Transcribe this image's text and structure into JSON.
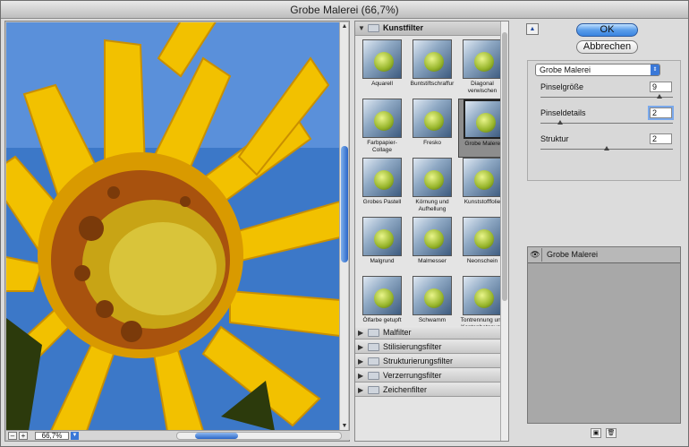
{
  "window": {
    "title": "Grobe Malerei (66,7%)"
  },
  "preview": {
    "zoom": "66,7%",
    "zoom_out": "–",
    "zoom_in": "+"
  },
  "gallery": {
    "open_category": "Kunstfilter",
    "filters": [
      {
        "name": "Aquarell",
        "selected": false
      },
      {
        "name": "Buntstiftschraffur",
        "selected": false
      },
      {
        "name": "Diagonal verwischen",
        "selected": false
      },
      {
        "name": "Farbpapier-Collage",
        "selected": false
      },
      {
        "name": "Fresko",
        "selected": false
      },
      {
        "name": "Grobe Malerei",
        "selected": true
      },
      {
        "name": "Grobes Pastell",
        "selected": false
      },
      {
        "name": "Körnung und Aufhellung",
        "selected": false
      },
      {
        "name": "Kunststofffolie",
        "selected": false
      },
      {
        "name": "Malgrund",
        "selected": false
      },
      {
        "name": "Malmesser",
        "selected": false
      },
      {
        "name": "Neonschein",
        "selected": false
      },
      {
        "name": "Ölfarbe getupft",
        "selected": false
      },
      {
        "name": "Schwamm",
        "selected": false
      },
      {
        "name": "Tontrennung und Kantenbetonung",
        "selected": false
      }
    ],
    "categories": [
      "Malfilter",
      "Stilisierungsfilter",
      "Strukturierungsfilter",
      "Verzerrungsfilter",
      "Zeichenfilter"
    ]
  },
  "buttons": {
    "ok": "OK",
    "cancel": "Abbrechen"
  },
  "settings": {
    "filter_select": "Grobe Malerei",
    "params": [
      {
        "label": "Pinselgröße",
        "value": "9",
        "slider": 0.9
      },
      {
        "label": "Pinseldetails",
        "value": "2",
        "slider": 0.15
      },
      {
        "label": "Struktur",
        "value": "2",
        "slider": 0.5
      }
    ]
  },
  "layers": {
    "items": [
      "Grobe Malerei"
    ]
  },
  "colors": {
    "accent": "#3a84e0",
    "sunflower": "#f2c100",
    "sky": "#3c78c8"
  }
}
